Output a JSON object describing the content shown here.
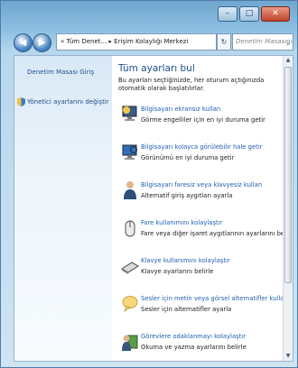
{
  "window": {
    "controls": {
      "minimize": "–",
      "maximize": "□",
      "close": "✕"
    }
  },
  "navigation": {
    "back_icon": "back-arrow-icon",
    "forward_icon": "forward-arrow-icon",
    "breadcrumb": [
      "Tüm Denet...",
      "Erişim Kolaylığı Merkezi"
    ],
    "breadcrumb_prefix": "«",
    "breadcrumb_separator": "▸",
    "refresh_label": "↻",
    "search_placeholder": "Denetim Masasında Ara"
  },
  "sidebar": {
    "items": [
      {
        "label": "Denetim Masası Giriş"
      },
      {
        "label": "Yönetici ayarlarını değiştir",
        "icon": "shield-icon"
      }
    ]
  },
  "main": {
    "title": "Tüm ayarları bul",
    "intro": "Bu ayarları seçtiğinizde, her oturum açtığınızda otomatik olarak başlatılırlar.",
    "items": [
      {
        "link": "Bilgisayarı ekransız kullan",
        "desc": "Görme engelliler için en iyi duruma getir",
        "icon": "monitor-off-icon"
      },
      {
        "link": "Bilgisayarı kolayca görülebilir hale getir",
        "desc": "Görünümü en iyi duruma getir",
        "icon": "monitor-magnifier-icon"
      },
      {
        "link": "Bilgisayarı faresiz veya klavyesiz kullan",
        "desc": "Alternatif giriş aygıtları ayarla",
        "icon": "person-icon"
      },
      {
        "link": "Fare kullanımını kolaylaştır",
        "desc": "Fare veya diğer işaret aygıtlarının ayarlarını belirle",
        "icon": "mouse-icon"
      },
      {
        "link": "Klavye kullanımını kolaylaştır",
        "desc": "Klavye ayarlarını belirle",
        "icon": "keyboard-icon"
      },
      {
        "link": "Sesler için metin veya görsel alternatifler kullan",
        "desc": "Sesler için alternatifler ayarla",
        "icon": "speech-bubble-icon"
      },
      {
        "link": "Görevlere odaklanmayı kolaylaştır",
        "desc": "Okuma ve yazma ayarlarını belirle",
        "icon": "reader-icon"
      }
    ]
  }
}
